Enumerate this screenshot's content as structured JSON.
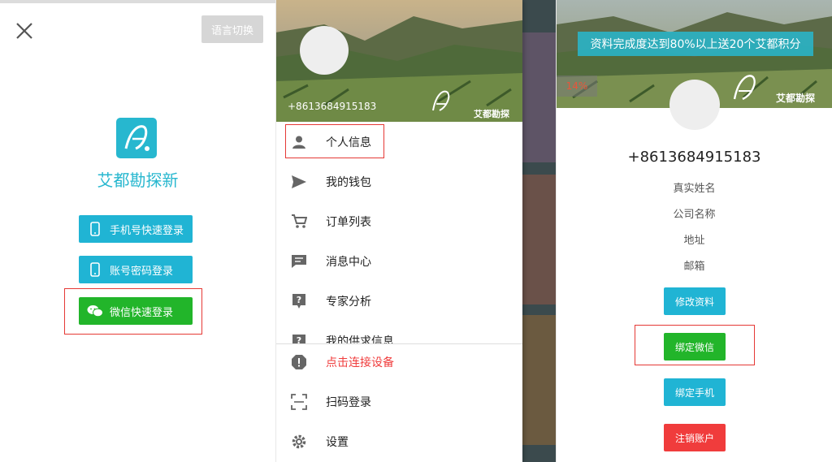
{
  "login": {
    "lang_switch": "语言切换",
    "app_name": "艾都勘探新",
    "phone_login": "手机号快速登录",
    "account_login": "账号密码登录",
    "wechat_login": "微信快速登录"
  },
  "drawer": {
    "phone": "+8613684915183",
    "brand": "艾都勘探",
    "menu": [
      {
        "label": "个人信息",
        "icon": "person-icon"
      },
      {
        "label": "我的钱包",
        "icon": "send-icon"
      },
      {
        "label": "订单列表",
        "icon": "cart-icon"
      },
      {
        "label": "消息中心",
        "icon": "chat-icon"
      },
      {
        "label": "专家分析",
        "icon": "question-icon"
      },
      {
        "label": "我的供求信息",
        "icon": "question-icon"
      }
    ],
    "connect": "点击连接设备",
    "scan_login": "扫码登录",
    "settings": "设置"
  },
  "profile": {
    "banner": "资料完成度达到80%以上送20个艾都积分",
    "progress": "14%",
    "brand": "艾都勘探",
    "phone": "+8613684915183",
    "real_name": "真实姓名",
    "company": "公司名称",
    "address": "地址",
    "email": "邮箱",
    "edit": "修改资料",
    "bind_wechat": "绑定微信",
    "bind_phone": "绑定手机",
    "logout": "注销账户"
  },
  "colors": {
    "accent": "#27b7cf",
    "wechat": "#22b52a",
    "highlight": "#e53935",
    "danger": "#f03c3c"
  }
}
